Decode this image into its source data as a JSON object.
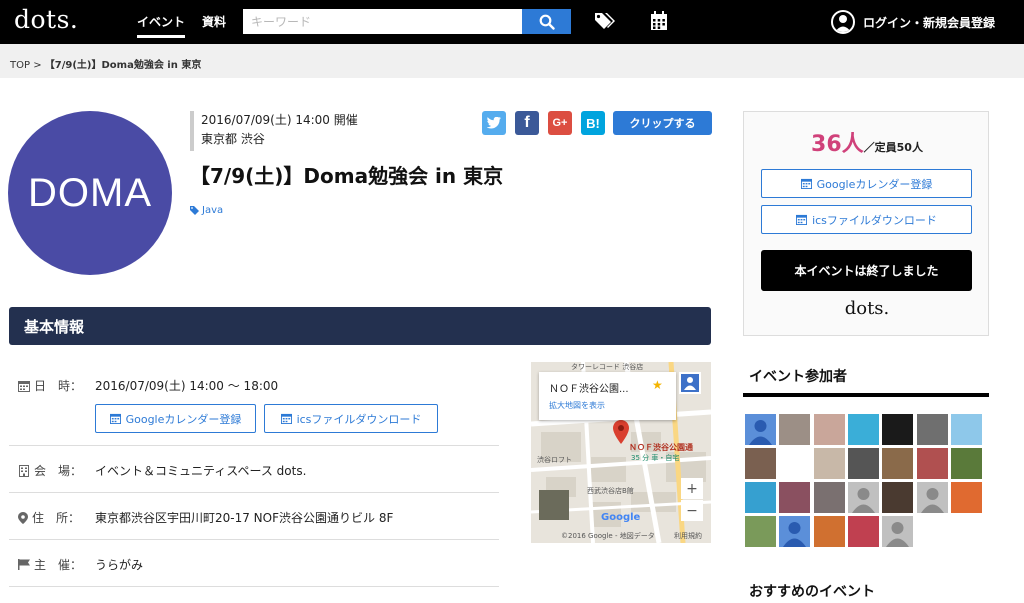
{
  "header": {
    "logo": "dots.",
    "nav": {
      "event": "イベント",
      "docs": "資料"
    },
    "search_placeholder": "キーワード",
    "login_label": "ログイン・新規会員登録"
  },
  "breadcrumb": {
    "home": "TOP",
    "separator": ">",
    "current": "【7/9(土)】Doma勉強会 in 東京"
  },
  "event": {
    "logo_text": "DOMA",
    "datetime": "2016/07/09(土) 14:00 開催",
    "location": "東京都 渋谷",
    "share": {
      "twitter": "twitter",
      "facebook": "f",
      "google_plus": "G+",
      "hatena": "B!"
    },
    "clip_label": "クリップする",
    "title": "【7/9(土)】Doma勉強会 in 東京",
    "tag": "Java"
  },
  "basic_info": {
    "heading": "基本情報",
    "rows": [
      {
        "label": "日　時：",
        "value": "2016/07/09(土) 14:00 〜 18:00",
        "icon": "calendar-icon"
      },
      {
        "label": "会　場：",
        "value": "イベント＆コミュニティスペース dots.",
        "icon": "building-icon"
      },
      {
        "label": "住　所：",
        "value": "東京都渋谷区宇田川町20-17 NOF渋谷公園通りビル 8F",
        "icon": "map-marker-icon"
      },
      {
        "label": "主　催：",
        "value": "うらがみ",
        "icon": "flag-icon"
      }
    ],
    "google_cal_label": "Googleカレンダー登録",
    "ics_label": "icsファイルダウンロード"
  },
  "map": {
    "card_title": "ＮＯＦ渋谷公園...",
    "card_link": "拡大地図を表示",
    "pin_label": "ＮＯＦ渋谷公園通",
    "pin_sub": "35 分 車・自宅",
    "place_loft": "渋谷ロフト",
    "place_seibu": "西武渋谷店B館",
    "place_tower": "タワーレコード 渋谷店",
    "copyright": "©2016 Google - 地図データ",
    "terms": "利用規約",
    "google": "Google",
    "zoom_in": "+",
    "zoom_out": "−"
  },
  "sidebar": {
    "count": "36人",
    "capacity": "／定員50人",
    "google_cal_label": "Googleカレンダー登録",
    "ics_label": "icsファイルダウンロード",
    "ended_label": "本イベントは終了しました",
    "logo": "dots.",
    "attendees_heading": "イベント参加者",
    "recommend_heading": "おすすめのイベント"
  },
  "colors": {
    "header_bg": "#000000",
    "accent_blue": "#2d7ad6",
    "section_navy": "#23304f",
    "count_pink": "#d0417a",
    "doma_purple": "#4a4ba5"
  },
  "attendees": [
    "#5b8fd9",
    "#9c8f86",
    "#c9a69a",
    "#3aaed8",
    "#1a1a1a",
    "#6f6f6f",
    "#8ec8ea",
    "#7a6050",
    "#ffffff",
    "#c8b8a8",
    "#555555",
    "#8a6a4a",
    "#b05050",
    "#5a7a3a",
    "#36a0d0",
    "#8a5060",
    "#7a7070",
    "#c0c0c0",
    "#4a3a30",
    "#c0c0c0",
    "#e06a30",
    "#7a9a5a",
    "#5b8fd9",
    "#d07030",
    "#c04050",
    "#c0c0c0"
  ]
}
